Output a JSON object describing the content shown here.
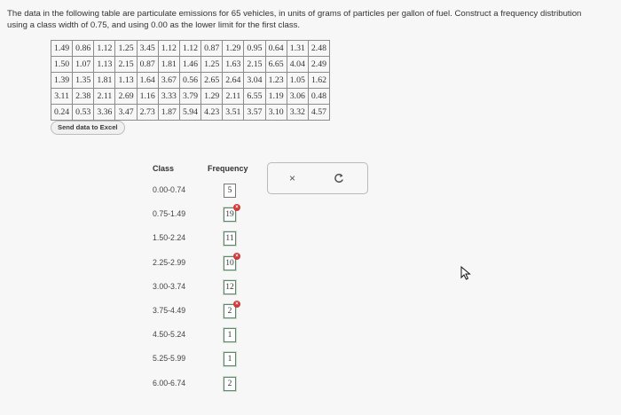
{
  "prompt": "The data in the following table are particulate emissions for 65 vehicles, in units of grams of particles per gallon of fuel. Construct a frequency distribution using a class width of 0.75, and using 0.00 as the lower limit for the first class.",
  "data_table": [
    [
      "1.49",
      "0.86",
      "1.12",
      "1.25",
      "3.45",
      "1.12",
      "1.12",
      "0.87",
      "1.29",
      "0.95",
      "0.64",
      "1.31",
      "2.48"
    ],
    [
      "1.50",
      "1.07",
      "1.13",
      "2.15",
      "0.87",
      "1.81",
      "1.46",
      "1.25",
      "1.63",
      "2.15",
      "6.65",
      "4.04",
      "2.49"
    ],
    [
      "1.39",
      "1.35",
      "1.81",
      "1.13",
      "1.64",
      "3.67",
      "0.56",
      "2.65",
      "2.64",
      "3.04",
      "1.23",
      "1.05",
      "1.62"
    ],
    [
      "3.11",
      "2.38",
      "2.11",
      "2.69",
      "1.16",
      "3.33",
      "3.79",
      "1.29",
      "2.11",
      "6.55",
      "1.19",
      "3.06",
      "0.48"
    ],
    [
      "0.24",
      "0.53",
      "3.36",
      "3.47",
      "2.73",
      "1.87",
      "5.94",
      "4.23",
      "3.51",
      "3.57",
      "3.10",
      "3.32",
      "4.57"
    ]
  ],
  "send_to_excel_label": "Send data to Excel",
  "freq_table": {
    "class_header": "Class",
    "frequency_header": "Frequency",
    "rows": [
      {
        "class": "0.00-0.74",
        "frequency": "5",
        "error": false
      },
      {
        "class": "0.75-1.49",
        "frequency": "19",
        "error": true
      },
      {
        "class": "1.50-2.24",
        "frequency": "11",
        "error": false
      },
      {
        "class": "2.25-2.99",
        "frequency": "10",
        "error": true
      },
      {
        "class": "3.00-3.74",
        "frequency": "12",
        "error": false
      },
      {
        "class": "3.75-4.49",
        "frequency": "2",
        "error": true
      },
      {
        "class": "4.50-5.24",
        "frequency": "1",
        "error": false
      },
      {
        "class": "5.25-5.99",
        "frequency": "1",
        "error": false
      },
      {
        "class": "6.00-6.74",
        "frequency": "2",
        "error": false
      }
    ]
  },
  "tools": {
    "clear_icon": "×",
    "undo_icon": "undo-icon"
  },
  "colors": {
    "error": "#d23a3a",
    "box_border": "#777777"
  }
}
